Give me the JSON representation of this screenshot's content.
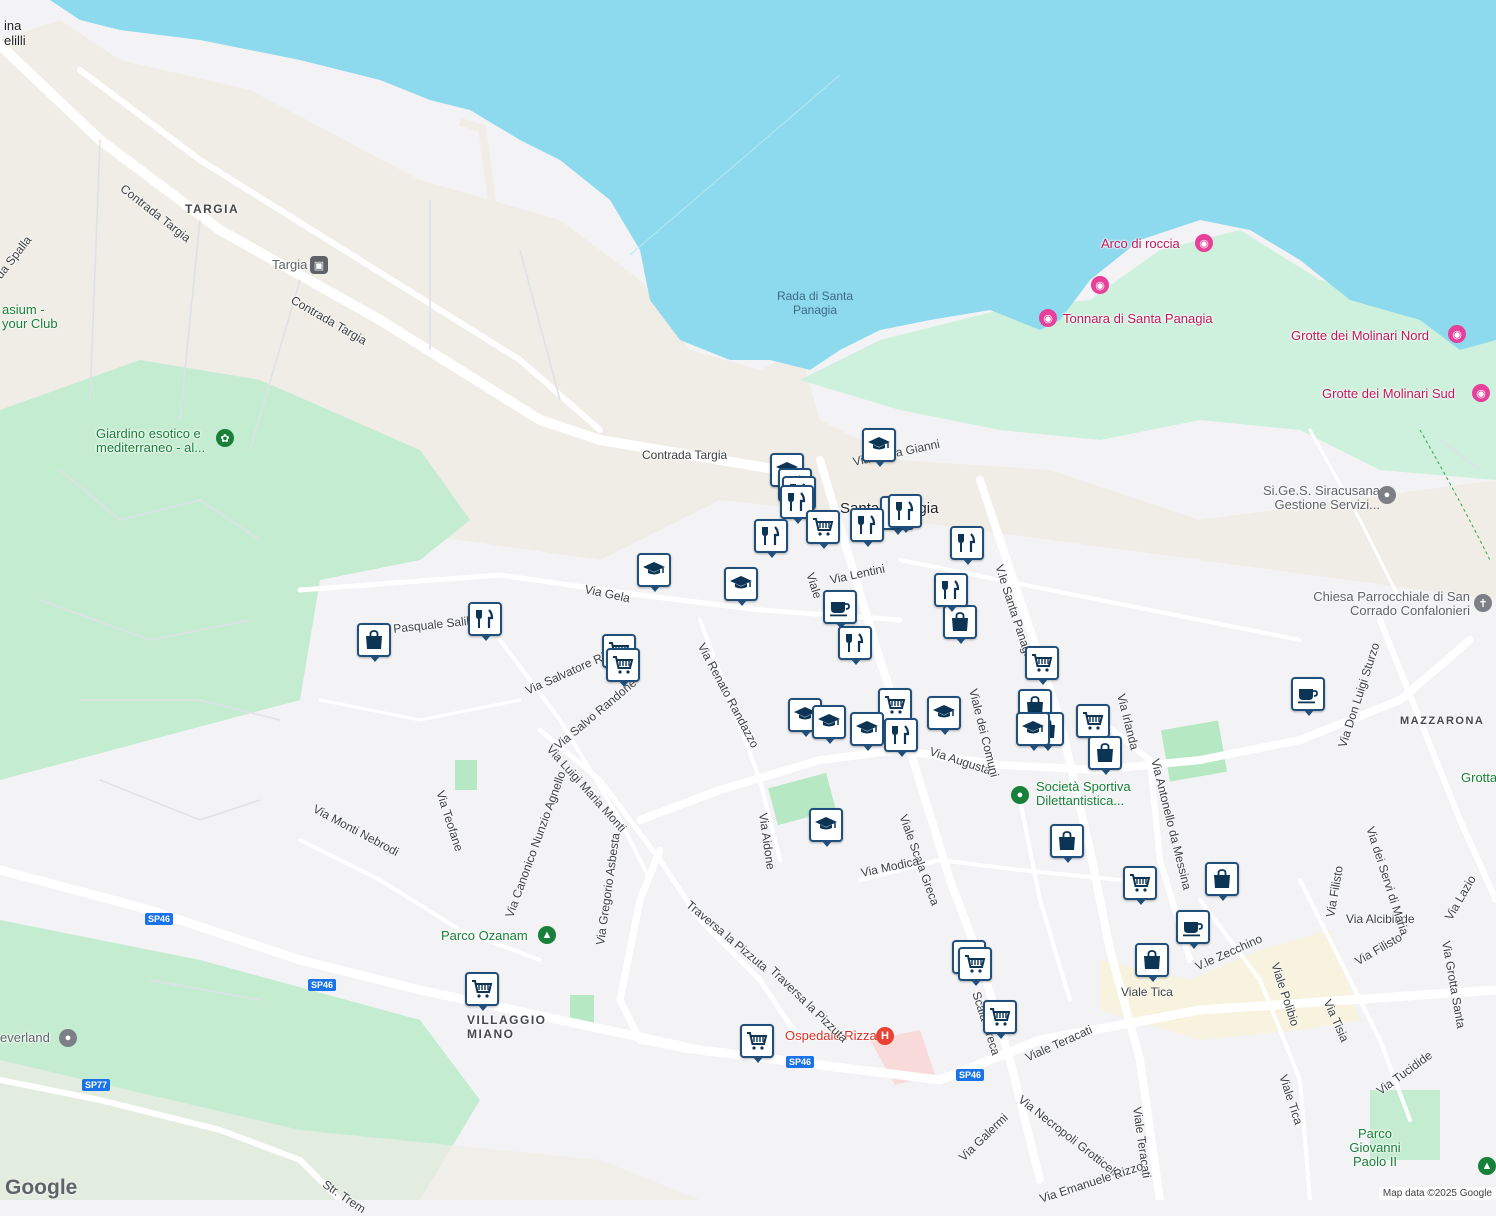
{
  "map": {
    "colors": {
      "water": "#8dd9ee",
      "park": "#cdf1dd",
      "forest": "#c4ecd1",
      "land": "#f3f3f5",
      "sand": "#efede5",
      "road": "#ffffff",
      "marker_border": "#1f4f7a"
    },
    "water_labels": [
      {
        "text": "Rada di Santa Panagia"
      }
    ],
    "place_labels": {
      "targia": "TARGIA",
      "santa_panagia": "Santa Panagia",
      "villaggio_miano": "VILLAGGIO MIANO",
      "mazzarona": "MAZZARONA",
      "top_left": "ina elilli"
    },
    "pois": {
      "arco": "Arco di roccia",
      "tonnara": "Tonnara di Santa Panagia",
      "molinari_nord": "Grotte dei Molinari Nord",
      "molinari_sud": "Grotte dei Molinari Sud",
      "giardino": "Giardino esotico e mediterraneo - al...",
      "sigess": "Si.Ge.S. Siracusana Gestione Servizi...",
      "chiesa": "Chiesa Parrocchiale di San Corrado Confalonieri",
      "societa": "Società Sportiva Dilettantistica...",
      "parco_ozanam": "Parco Ozanam",
      "parco_gp": "Parco Giovanni Paolo II",
      "ospedale": "Ospedale Rizza",
      "targia_station": "Targia",
      "gymnasium": "asium - your Club",
      "everland": "everland",
      "grotta": "Grotta"
    },
    "streets": {
      "contrada_targia_1": "Contrada Targia",
      "contrada_targia_2": "Contrada Targia",
      "contrada_targia_3": "Contrada Targia",
      "spalla": "da Spalla",
      "via_gela": "Via Gela",
      "pasquale": "Via Pasquale Salibra",
      "salvatore": "Via Salvatore Ri",
      "salvo_randone": "Via Salvo Randone",
      "luigi_maria_monti": "Via Luigi Maria Monti",
      "renato_randazzo": "Via Renato Randazzo",
      "lentini": "Via Lentini",
      "maria_gianni": "Via Maria Gianni",
      "santa_panagia": "V.le Santa Panagia",
      "viale_scala_greca": "Viale Scala Greca",
      "scala_greca_2": "Scala Greca",
      "via_augusta": "Via Augusta",
      "viale_comuni": "Viale dei Comuni",
      "antonello": "Via Antonello da Messina",
      "irlanda": "Via Irlanda",
      "don_luigi": "Via Don Luigi Sturzo",
      "aidone": "Via Aidone",
      "modica": "Via Modica",
      "traversa1": "Traversa la Pizzuta",
      "traversa2": "Traversa la Pizzuta",
      "teofane": "Via Teofane",
      "monti_nebrodi": "Via Monti Nebrodi",
      "canonico": "Via Canonico Nunzio Agnello",
      "gregorio": "Via Gregorio Asbesta",
      "teracati1": "Viale Teracati",
      "teracati2": "Viale Teracati",
      "necropoli": "Via Necropoli Grotticelle",
      "galermi": "Via Galermi",
      "emanuele": "Via Emanuele Rizzo",
      "tica1": "Viale Tica",
      "tica2": "Viale Tica",
      "zecchino": "V.le Zecchino",
      "polibio": "Viale Polibio",
      "filisto1": "Via Filisto",
      "filisto2": "Via Filisto",
      "alcibiade": "Via Alcibiade",
      "tisia": "Via Tisia",
      "servi": "Via dei Servi di Maria",
      "grotta_santa": "Via Grotta Santa",
      "lazio": "Via Lazio",
      "tucidide": "Via Tucidide",
      "str_trem": "Str. Trem",
      "viale_c": "Viale",
      "sp46_1": "SP46",
      "sp46_2": "SP46",
      "sp46_3": "SP46",
      "sp46_4": "SP46",
      "sp77": "SP77"
    },
    "markers": [
      {
        "type": "school"
      },
      {
        "type": "restaurant"
      },
      {
        "type": "restaurant"
      },
      {
        "type": "restaurant"
      },
      {
        "type": "school"
      },
      {
        "type": "restaurant"
      },
      {
        "type": "restaurant"
      },
      {
        "type": "grocery"
      },
      {
        "type": "restaurant"
      },
      {
        "type": "restaurant"
      },
      {
        "type": "school"
      },
      {
        "type": "school"
      },
      {
        "type": "restaurant"
      },
      {
        "type": "shopping"
      },
      {
        "type": "grocery"
      },
      {
        "type": "grocery"
      },
      {
        "type": "cafe"
      },
      {
        "type": "restaurant"
      },
      {
        "type": "restaurant"
      },
      {
        "type": "shopping"
      },
      {
        "type": "restaurant"
      },
      {
        "type": "grocery"
      },
      {
        "type": "school"
      },
      {
        "type": "school"
      },
      {
        "type": "grocery"
      },
      {
        "type": "school"
      },
      {
        "type": "school"
      },
      {
        "type": "restaurant"
      },
      {
        "type": "school"
      },
      {
        "type": "shopping"
      },
      {
        "type": "shopping"
      },
      {
        "type": "grocery"
      },
      {
        "type": "shopping"
      },
      {
        "type": "cafe"
      },
      {
        "type": "school"
      },
      {
        "type": "shopping"
      },
      {
        "type": "grocery"
      },
      {
        "type": "shopping"
      },
      {
        "type": "cafe"
      },
      {
        "type": "shopping"
      },
      {
        "type": "grocery"
      },
      {
        "type": "grocery"
      },
      {
        "type": "grocery"
      },
      {
        "type": "grocery"
      },
      {
        "type": "grocery"
      }
    ],
    "attribution": "Map data ©2025 Google",
    "logo": "Google"
  }
}
